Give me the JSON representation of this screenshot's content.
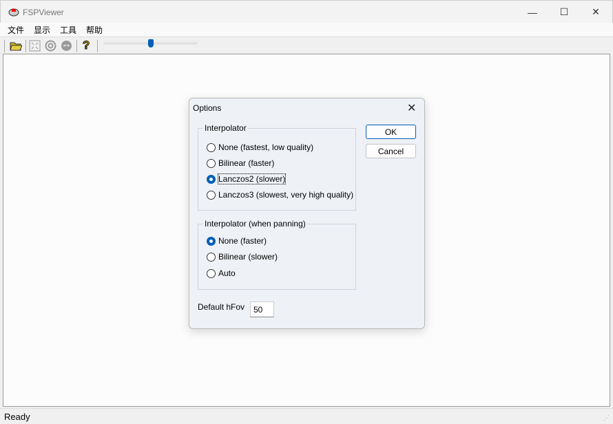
{
  "window": {
    "title": "FSPViewer",
    "minimize": "—",
    "maximize": "☐",
    "close": "✕"
  },
  "menu": [
    "文件",
    "显示",
    "工具",
    "帮助"
  ],
  "toolbar": {
    "slider_value": 0.5
  },
  "status": "Ready",
  "dialog": {
    "title": "Options",
    "close": "✕",
    "ok": "OK",
    "cancel": "Cancel",
    "group1": {
      "label": "Interpolator",
      "options": [
        "None (fastest, low quality)",
        "Bilinear (faster)",
        "Lanczos2 (slower)",
        "Lanczos3 (slowest, very high quality)"
      ],
      "selected": 2
    },
    "group2": {
      "label": "Interpolator (when panning)",
      "options": [
        "None (faster)",
        "Bilinear (slower)",
        "Auto"
      ],
      "selected": 0
    },
    "hfov_label": "Default hFov",
    "hfov_value": "50"
  }
}
